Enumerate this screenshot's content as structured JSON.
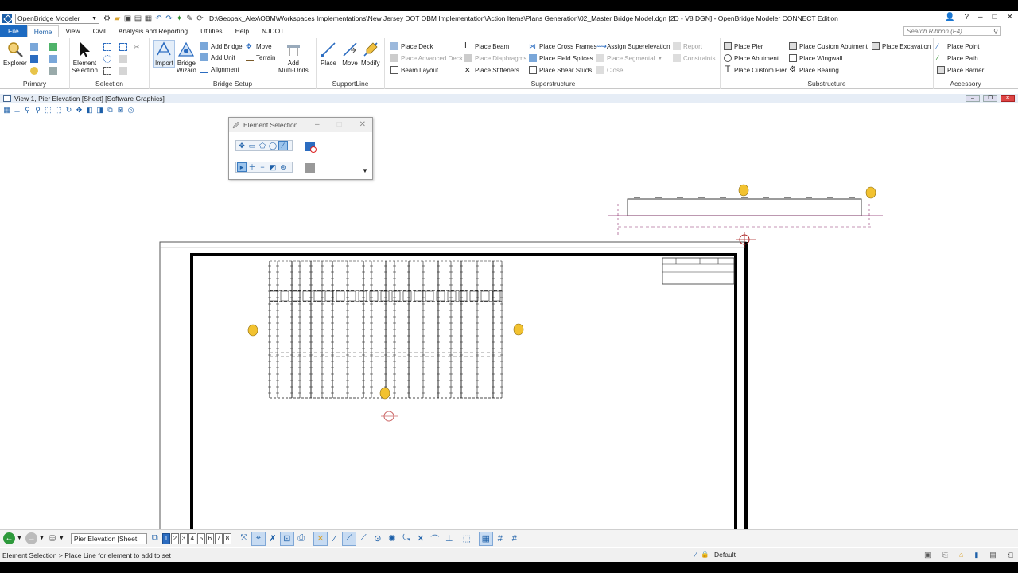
{
  "app": {
    "workspace": "OpenBridge Modeler",
    "title": "D:\\Geopak_Alex\\OBM\\Workspaces Implementations\\New Jersey DOT OBM Implementation\\Action Items\\Plans Generation\\02_Master Bridge Model.dgn [2D - V8 DGN] - OpenBridge Modeler CONNECT Edition"
  },
  "tabs": [
    "File",
    "Home",
    "View",
    "Civil",
    "Analysis and Reporting",
    "Utilities",
    "Help",
    "NJDOT"
  ],
  "search": {
    "placeholder": "Search Ribbon (F4)"
  },
  "ribbon": {
    "primary": {
      "label": "Primary",
      "explorer": "Explorer"
    },
    "selection": {
      "label": "Selection",
      "element_selection": "Element\nSelection"
    },
    "bridge_setup": {
      "label": "Bridge Setup",
      "import": "Import",
      "bridge_wizard": "Bridge\nWizard",
      "add_bridge": "Add Bridge",
      "add_unit": "Add Unit",
      "alignment": "Alignment",
      "move": "Move",
      "terrain": "Terrain",
      "add_multi_units": "Add\nMulti-Units"
    },
    "supportline": {
      "label": "SupportLine",
      "place": "Place",
      "move": "Move",
      "modify": "Modify"
    },
    "superstructure": {
      "label": "Superstructure",
      "place_deck": "Place Deck",
      "place_advanced_deck": "Place Advanced Deck",
      "beam_layout": "Beam Layout",
      "place_beam": "Place Beam",
      "place_diaphragms": "Place Diaphragms",
      "place_stiffeners": "Place Stiffeners",
      "place_cross_frames": "Place Cross Frames",
      "place_field_splices": "Place Field Splices",
      "place_shear_studs": "Place Shear Studs",
      "assign_superelevation": "Assign Superelevation",
      "place_segmental": "Place Segmental",
      "close": "Close",
      "report": "Report",
      "constraints": "Constraints"
    },
    "substructure": {
      "label": "Substructure",
      "place_pier": "Place Pier",
      "place_abutment": "Place Abutment",
      "place_custom_pier": "Place Custom Pier",
      "place_custom_abutment": "Place Custom Abutment",
      "place_wingwall": "Place Wingwall",
      "place_bearing": "Place Bearing",
      "place_excavation": "Place Excavation"
    },
    "accessory": {
      "label": "Accessory",
      "place_point": "Place Point",
      "place_path": "Place Path",
      "place_barrier": "Place Barrier"
    }
  },
  "view": {
    "title": "View 1, Pier Elevation [Sheet] [Software Graphics]"
  },
  "element_selection": {
    "title": "Element Selection"
  },
  "bottom": {
    "model": "Pier Elevation [Sheet",
    "view_numbers": [
      "1",
      "2",
      "3",
      "4",
      "5",
      "6",
      "7",
      "8"
    ]
  },
  "status": {
    "message": "Element Selection > Place Line for element to add to set",
    "level": "Default"
  },
  "colors": {
    "accent": "#1c6ac1",
    "ribbon_bg": "#ffffff",
    "marker": "#f2c230"
  }
}
